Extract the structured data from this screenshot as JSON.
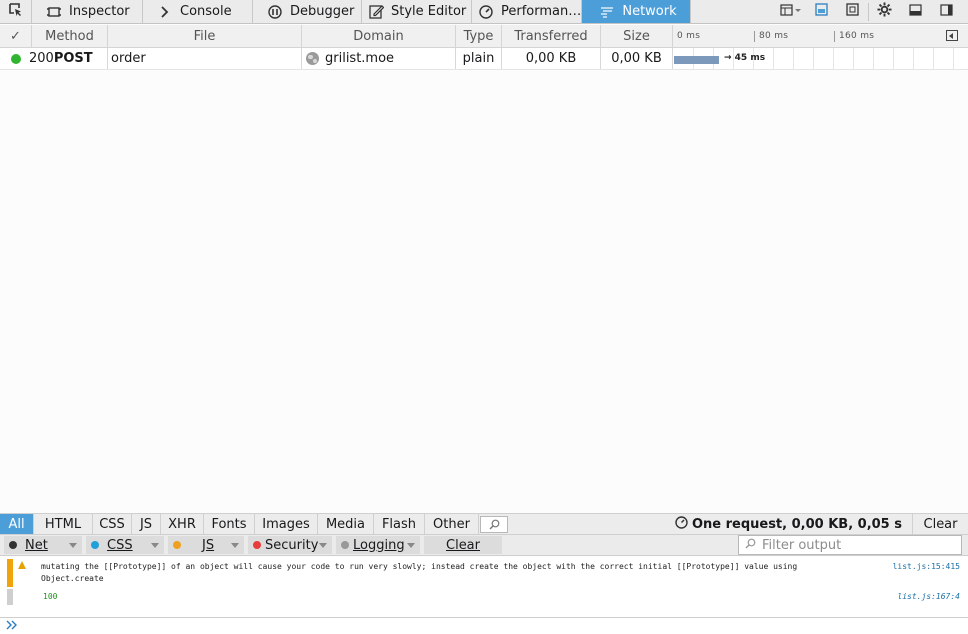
{
  "toolbar": {
    "tabs": [
      {
        "label": "Inspector",
        "icon": "inspector-icon"
      },
      {
        "label": "Console",
        "icon": "console-icon"
      },
      {
        "label": "Debugger",
        "icon": "debugger-icon"
      },
      {
        "label": "Style Editor",
        "icon": "style-editor-icon"
      },
      {
        "label": "Performan…",
        "icon": "performance-icon"
      },
      {
        "label": "Network",
        "icon": "network-icon",
        "selected": true
      }
    ],
    "accent_color": "#4c9ed9"
  },
  "network": {
    "columns": {
      "status": "✓",
      "method": "Method",
      "file": "File",
      "domain": "Domain",
      "type": "Type",
      "transferred": "Transferred",
      "size": "Size"
    },
    "waterfall_ticks": [
      "0 ms",
      "80 ms",
      "160 ms"
    ],
    "requests": [
      {
        "status": "200",
        "status_color": "#2fb52f",
        "method": "POST",
        "file": "order",
        "domain": "grilist.moe",
        "type": "plain",
        "transferred": "0,00 KB",
        "size": "0,00 KB",
        "timing": "→ 45 ms",
        "duration_ms": 45
      }
    ]
  },
  "filters": {
    "types": [
      "All",
      "HTML",
      "CSS",
      "JS",
      "XHR",
      "Fonts",
      "Images",
      "Media",
      "Flash",
      "Other"
    ],
    "active": "All",
    "summary": "One request, 0,00 KB, 0,05 s",
    "clear_label": "Clear"
  },
  "console": {
    "filters": [
      {
        "label": "Net",
        "color": "#333333"
      },
      {
        "label": "CSS",
        "color": "#1fa0d8"
      },
      {
        "label": "JS",
        "color": "#f0a020"
      },
      {
        "label": "Security",
        "color": "#e83b3b"
      },
      {
        "label": "Logging",
        "color": "#999999"
      }
    ],
    "clear_label": "Clear",
    "filter_placeholder": "Filter output",
    "messages": [
      {
        "level": "warning",
        "text": "mutating the [[Prototype]] of an object will cause your code to run very slowly; instead create the object with the correct initial [[Prototype]] value using Object.create",
        "source": "list.js:15:415"
      },
      {
        "level": "log",
        "text": "100",
        "source": "list.js:167:4"
      }
    ],
    "prompt": "»"
  }
}
